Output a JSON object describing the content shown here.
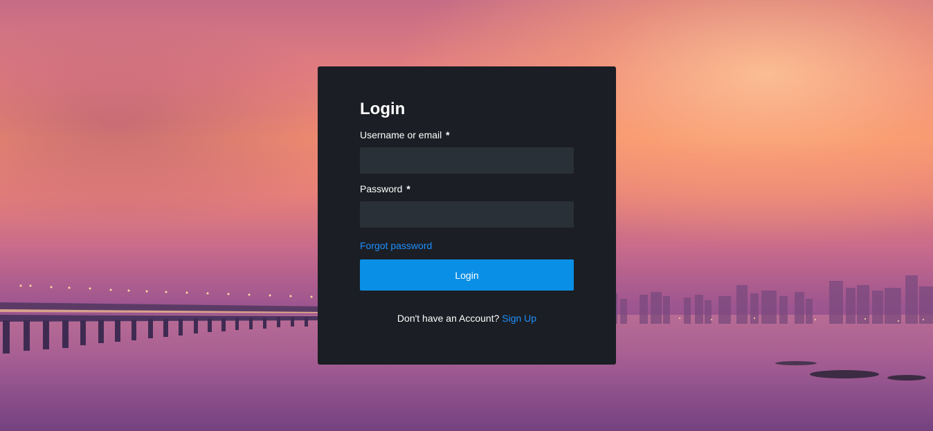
{
  "login": {
    "title": "Login",
    "username_label": "Username or email",
    "username_required": "*",
    "username_value": "",
    "password_label": "Password",
    "password_required": "*",
    "password_value": "",
    "forgot_password": "Forgot password",
    "submit_label": "Login",
    "no_account_text": "Don't have an Account?",
    "signup_link": "Sign Up"
  },
  "colors": {
    "card_background": "#1b1e24",
    "input_background": "#2a3038",
    "button_primary": "#0a8fe6",
    "link": "#1e90ff"
  }
}
